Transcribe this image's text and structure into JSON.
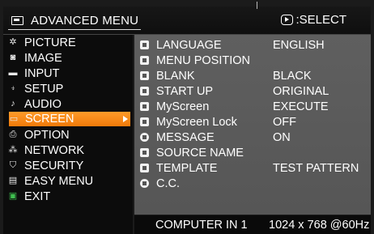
{
  "header": {
    "title": "ADVANCED MENU",
    "select_hint": ":SELECT",
    "icons": {
      "menu": "menu-card-icon",
      "select": "enter-key-icon"
    }
  },
  "left_menu": {
    "items": [
      {
        "label": "PICTURE",
        "icon": "sun-icon"
      },
      {
        "label": "IMAGE",
        "icon": "image-icon"
      },
      {
        "label": "INPUT",
        "icon": "input-icon"
      },
      {
        "label": "SETUP",
        "icon": "setup-icon"
      },
      {
        "label": "AUDIO",
        "icon": "music-note-icon"
      },
      {
        "label": "SCREEN",
        "icon": "screen-icon",
        "selected": true
      },
      {
        "label": "OPTION",
        "icon": "printer-icon"
      },
      {
        "label": "NETWORK",
        "icon": "network-icon"
      },
      {
        "label": "SECURITY",
        "icon": "shield-icon"
      },
      {
        "label": "EASY MENU",
        "icon": "easy-menu-icon"
      },
      {
        "label": "EXIT",
        "icon": "exit-icon"
      }
    ]
  },
  "screen_panel": {
    "rows": [
      {
        "label": "LANGUAGE",
        "value": "ENGLISH",
        "icon": "language-icon"
      },
      {
        "label": "MENU POSITION",
        "value": "",
        "icon": "menu-position-icon"
      },
      {
        "label": "BLANK",
        "value": "BLACK",
        "icon": "blank-icon"
      },
      {
        "label": "START UP",
        "value": "ORIGINAL",
        "icon": "start-up-icon"
      },
      {
        "label": "MyScreen",
        "value": "EXECUTE",
        "icon": "myscreen-icon"
      },
      {
        "label": "MyScreen Lock",
        "value": "OFF",
        "icon": "lock-icon"
      },
      {
        "label": "MESSAGE",
        "value": "ON",
        "icon": "message-icon"
      },
      {
        "label": "SOURCE NAME",
        "value": "",
        "icon": "source-name-icon"
      },
      {
        "label": "TEMPLATE",
        "value": "TEST PATTERN",
        "icon": "template-icon"
      },
      {
        "label": "C.C.",
        "value": "",
        "icon": "cc-icon"
      }
    ]
  },
  "status_bar": {
    "source": "COMPUTER IN 1",
    "resolution": "1024 x 768 @60Hz"
  },
  "colors": {
    "selected_bg": "#f58a1a",
    "panel_bg": "#5c5c5c",
    "menu_bg": "#0c0c0c",
    "exit_icon": "#3fbf4f"
  }
}
